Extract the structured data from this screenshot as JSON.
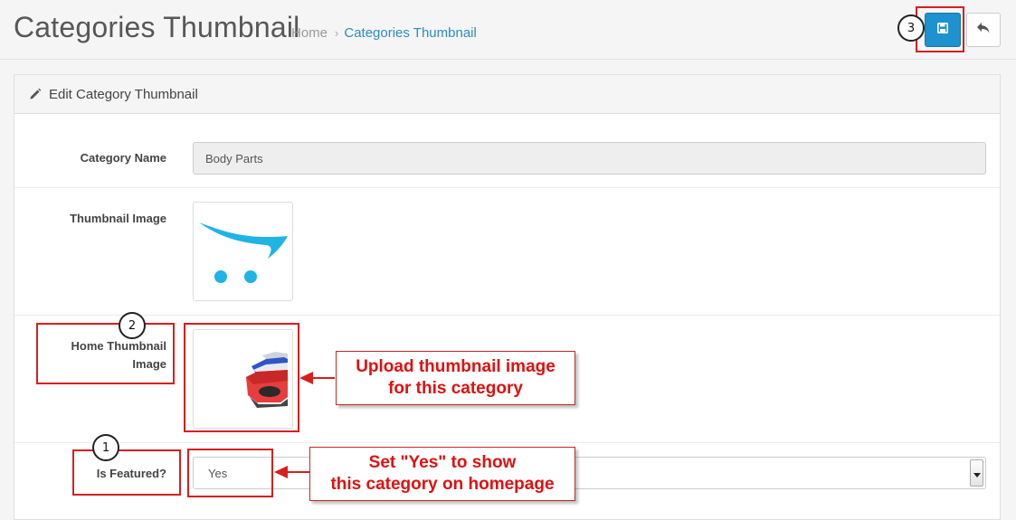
{
  "header": {
    "title": "Categories Thumbnail",
    "breadcrumb": {
      "home": "Home",
      "separator": "›",
      "current": "Categories Thumbnail"
    },
    "save_icon": "save-icon",
    "back_icon": "reply-icon"
  },
  "panel": {
    "heading": "Edit Category Thumbnail",
    "heading_icon": "pencil-icon"
  },
  "form": {
    "category_name_label": "Category Name",
    "category_name_value": "Body Parts",
    "thumbnail_label": "Thumbnail Image",
    "home_thumbnail_label_line1": "Home Thumbnail",
    "home_thumbnail_label_line2": "Image",
    "is_featured_label": "Is Featured?",
    "is_featured_value": "Yes"
  },
  "annotations": {
    "badge_1": "1",
    "badge_2": "2",
    "badge_3": "3",
    "callout_upload_line1": "Upload thumbnail image",
    "callout_upload_line2": "for this category",
    "callout_featured_line1": "Set \"Yes\" to show",
    "callout_featured_line2": "this category on homepage"
  },
  "colors": {
    "primary": "#1e91cf",
    "link": "#2a8ec0",
    "annotation_red": "#d81e1e",
    "logo_cyan": "#1fb3e6"
  }
}
